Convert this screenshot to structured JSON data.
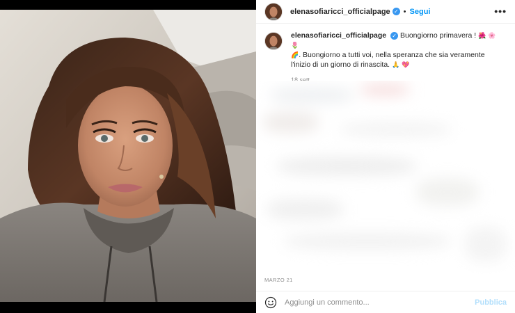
{
  "post": {
    "username": "elenasofiaricci_officialpage",
    "verified": true,
    "follow_label": "Segui",
    "separator": "•",
    "more_label": "•••",
    "caption": {
      "username": "elenasofiaricci_officialpage",
      "text_line1": "Buongiorno primavera !",
      "emoji_line1": "🌺 🌸 🌷",
      "emoji_line2": "🌈",
      "text_line2": ". Buongiorno a tutti voi, nella speranza che sia veramente l'inizio di un giorno di rinascita.",
      "emoji_end": "🙏 💖",
      "time": "18 sett."
    },
    "date": "MARZO 21",
    "comment_placeholder": "Aggiungi un commento...",
    "publish_label": "Pubblica"
  },
  "icons": {
    "avatar": "profile-avatar",
    "verified": "verified-badge-icon",
    "more": "more-options-icon",
    "emoji": "smiley-icon"
  },
  "colors": {
    "link": "#0095f6",
    "publish_disabled": "#b2dffc",
    "verified": "#3897f0",
    "muted": "#8e8e8e"
  }
}
